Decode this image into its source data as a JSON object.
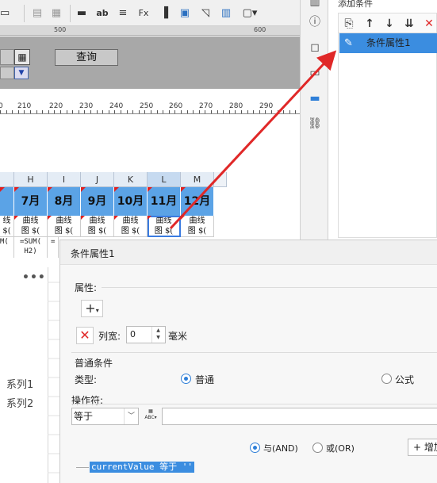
{
  "ruler_top": [
    "500",
    "600"
  ],
  "query_button": "查询",
  "ruler_bottom": [
    "0",
    "210",
    "220",
    "230",
    "240",
    "250",
    "260",
    "270",
    "280",
    "290"
  ],
  "columns": [
    "H",
    "I",
    "J",
    "K",
    "L",
    "M"
  ],
  "months": [
    "7月",
    "8月",
    "9月",
    "10月",
    "11月",
    "12月"
  ],
  "cells": {
    "curve_line1": "曲线",
    "curve_line2": "图 $(",
    "selected_line1": "曲线",
    "selected_line2": "图 $(",
    "sum_h": "=SUM(\nH2)",
    "sum_i": "=",
    "partial_left": "线",
    "partial_left2": "$(",
    "partial_sum": "M("
  },
  "left_panel": {
    "more": "•••",
    "series1": "系列1",
    "series2": "系列2"
  },
  "conditions_panel": {
    "title": "添加条件",
    "item": "条件属性1"
  },
  "properties": {
    "title": "条件属性1",
    "attr_label": "属性:",
    "width_label": "列宽:",
    "width_value": "0",
    "width_unit": "毫米",
    "normal_condition": "普通条件",
    "type_label": "类型:",
    "type_normal": "普通",
    "type_formula": "公式",
    "operator_label": "操作符:",
    "operator_value": "等于",
    "and_label": "与(AND)",
    "or_label": "或(OR)",
    "add_label": "增加",
    "formula_text": "currentValue 等于 ''"
  },
  "colors": {
    "accent": "#3b8de0",
    "month_header": "#5ba3e6",
    "arrow": "#e02828"
  }
}
